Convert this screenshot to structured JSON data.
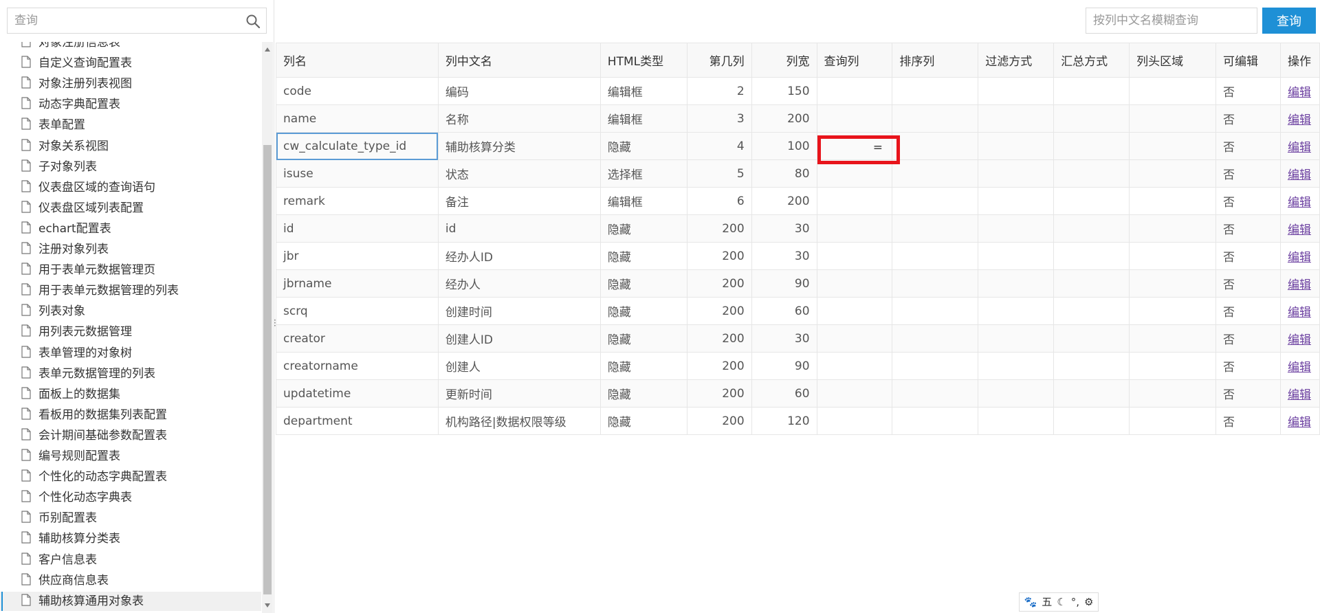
{
  "sidebar": {
    "search_placeholder": "查询",
    "items": [
      {
        "label": "对象注册信息表"
      },
      {
        "label": "自定义查询配置表"
      },
      {
        "label": "对象注册列表视图"
      },
      {
        "label": "动态字典配置表"
      },
      {
        "label": "表单配置"
      },
      {
        "label": "对象关系视图"
      },
      {
        "label": "子对象列表"
      },
      {
        "label": "仪表盘区域的查询语句"
      },
      {
        "label": "仪表盘区域列表配置"
      },
      {
        "label": "echart配置表"
      },
      {
        "label": "注册对象列表"
      },
      {
        "label": "用于表单元数据管理页"
      },
      {
        "label": "用于表单元数据管理的列表"
      },
      {
        "label": "列表对象"
      },
      {
        "label": "用列表元数据管理"
      },
      {
        "label": "表单管理的对象树"
      },
      {
        "label": "表单元数据管理的列表"
      },
      {
        "label": "面板上的数据集"
      },
      {
        "label": "看板用的数据集列表配置"
      },
      {
        "label": "会计期间基础参数配置表"
      },
      {
        "label": "编号规则配置表"
      },
      {
        "label": "个性化的动态字典配置表"
      },
      {
        "label": "个性化动态字典表"
      },
      {
        "label": "币别配置表"
      },
      {
        "label": "辅助核算分类表"
      },
      {
        "label": "客户信息表"
      },
      {
        "label": "供应商信息表"
      },
      {
        "label": "辅助核算通用对象表"
      }
    ]
  },
  "toolbar": {
    "search_placeholder": "按列中文名模糊查询",
    "query_label": "查询"
  },
  "table": {
    "headers": [
      "列名",
      "列中文名",
      "HTML类型",
      "第几列",
      "列宽",
      "查询列",
      "排序列",
      "过滤方式",
      "汇总方式",
      "列头区域",
      "可编辑",
      "操作"
    ],
    "rows": [
      {
        "name": "code",
        "cn_name": "编码",
        "html_type": "编辑框",
        "order": "2",
        "width": "150",
        "query": "",
        "sort": "",
        "filter": "",
        "summary": "",
        "header_area": "",
        "editable": "否",
        "action": "编辑"
      },
      {
        "name": "name",
        "cn_name": "名称",
        "html_type": "编辑框",
        "order": "3",
        "width": "200",
        "query": "",
        "sort": "",
        "filter": "",
        "summary": "",
        "header_area": "",
        "editable": "否",
        "action": "编辑"
      },
      {
        "name": "cw_calculate_type_id",
        "cn_name": "辅助核算分类",
        "html_type": "隐藏",
        "order": "4",
        "width": "100",
        "query": "=",
        "sort": "",
        "filter": "",
        "summary": "",
        "header_area": "",
        "editable": "否",
        "action": "编辑"
      },
      {
        "name": "isuse",
        "cn_name": "状态",
        "html_type": "选择框",
        "order": "5",
        "width": "80",
        "query": "",
        "sort": "",
        "filter": "",
        "summary": "",
        "header_area": "",
        "editable": "否",
        "action": "编辑"
      },
      {
        "name": "remark",
        "cn_name": "备注",
        "html_type": "编辑框",
        "order": "6",
        "width": "200",
        "query": "",
        "sort": "",
        "filter": "",
        "summary": "",
        "header_area": "",
        "editable": "否",
        "action": "编辑"
      },
      {
        "name": "id",
        "cn_name": "id",
        "html_type": "隐藏",
        "order": "200",
        "width": "30",
        "query": "",
        "sort": "",
        "filter": "",
        "summary": "",
        "header_area": "",
        "editable": "否",
        "action": "编辑"
      },
      {
        "name": "jbr",
        "cn_name": "经办人ID",
        "html_type": "隐藏",
        "order": "200",
        "width": "30",
        "query": "",
        "sort": "",
        "filter": "",
        "summary": "",
        "header_area": "",
        "editable": "否",
        "action": "编辑"
      },
      {
        "name": "jbrname",
        "cn_name": "经办人",
        "html_type": "隐藏",
        "order": "200",
        "width": "90",
        "query": "",
        "sort": "",
        "filter": "",
        "summary": "",
        "header_area": "",
        "editable": "否",
        "action": "编辑"
      },
      {
        "name": "scrq",
        "cn_name": "创建时间",
        "html_type": "隐藏",
        "order": "200",
        "width": "60",
        "query": "",
        "sort": "",
        "filter": "",
        "summary": "",
        "header_area": "",
        "editable": "否",
        "action": "编辑"
      },
      {
        "name": "creator",
        "cn_name": "创建人ID",
        "html_type": "隐藏",
        "order": "200",
        "width": "30",
        "query": "",
        "sort": "",
        "filter": "",
        "summary": "",
        "header_area": "",
        "editable": "否",
        "action": "编辑"
      },
      {
        "name": "creatorname",
        "cn_name": "创建人",
        "html_type": "隐藏",
        "order": "200",
        "width": "90",
        "query": "",
        "sort": "",
        "filter": "",
        "summary": "",
        "header_area": "",
        "editable": "否",
        "action": "编辑"
      },
      {
        "name": "updatetime",
        "cn_name": "更新时间",
        "html_type": "隐藏",
        "order": "200",
        "width": "60",
        "query": "",
        "sort": "",
        "filter": "",
        "summary": "",
        "header_area": "",
        "editable": "否",
        "action": "编辑"
      },
      {
        "name": "department",
        "cn_name": "机构路径|数据权限等级",
        "html_type": "隐藏",
        "order": "200",
        "width": "120",
        "query": "",
        "sort": "",
        "filter": "",
        "summary": "",
        "header_area": "",
        "editable": "否",
        "action": "编辑"
      }
    ]
  },
  "highlight": {
    "color": "#e8141b"
  },
  "ime": {
    "items": [
      "🐾",
      "五",
      "☾",
      "°,",
      "⚙"
    ]
  },
  "colors": {
    "accent": "#1e90d6",
    "link": "#6b3fa0",
    "active_cell_border": "#5b9bd5"
  }
}
